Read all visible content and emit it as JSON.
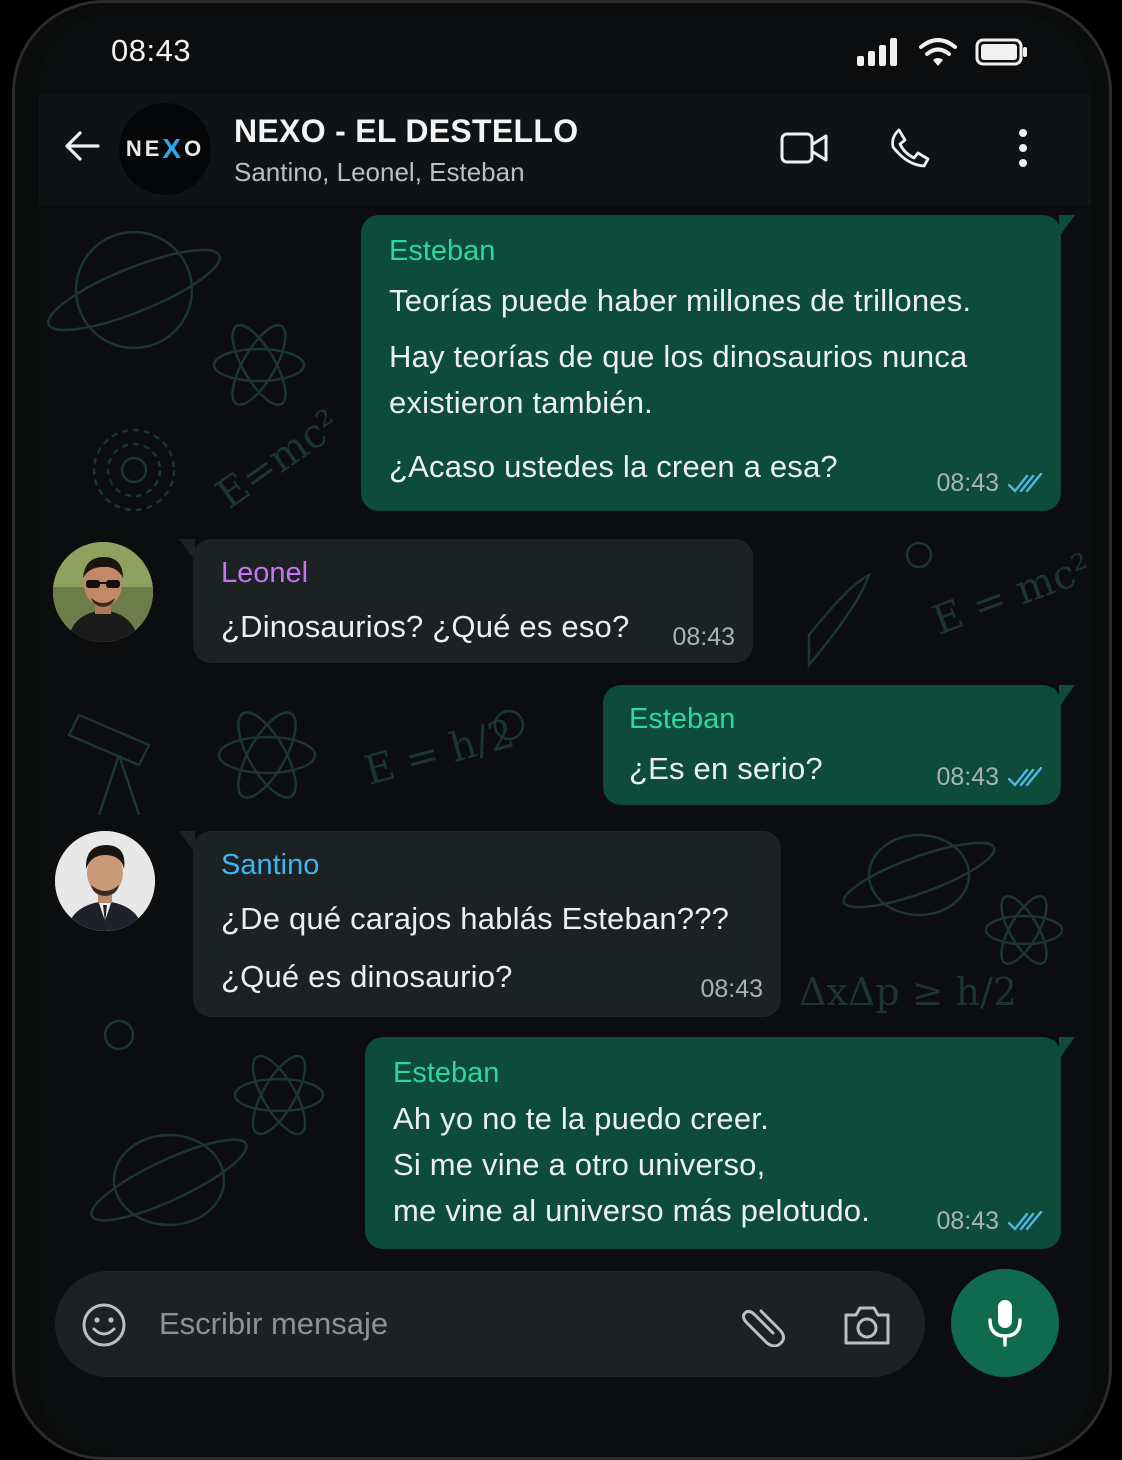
{
  "status_bar": {
    "time": "08:43"
  },
  "header": {
    "group_logo_left": "NE",
    "group_logo_mid": "X",
    "group_logo_right": "O",
    "title": "NEXO - EL DESTELLO",
    "members": "Santino, Leonel, Esteban"
  },
  "colors": {
    "outgoing_bubble": "#0d4c3a",
    "incoming_bubble": "#1c2124",
    "esteban": "#2fd6a0",
    "leonel": "#c774f2",
    "santino": "#3fb6f0",
    "read_ticks": "#4fb6e6",
    "mic_button": "#0f6a4e"
  },
  "messages": [
    {
      "sender": "Esteban",
      "direction": "out",
      "lines": [
        "Teorías puede haber millones de trillones.",
        "Hay teorías de que los dinosaurios nunca",
        "existieron también.",
        "¿Acaso ustedes la creen a esa?"
      ],
      "time": "08:43",
      "status": "read"
    },
    {
      "sender": "Leonel",
      "direction": "in",
      "lines": [
        "¿Dinosaurios? ¿Qué es eso?"
      ],
      "time": "08:43"
    },
    {
      "sender": "Esteban",
      "direction": "out",
      "lines": [
        "¿Es en serio?"
      ],
      "time": "08:43",
      "status": "read"
    },
    {
      "sender": "Santino",
      "direction": "in",
      "lines": [
        "¿De qué carajos hablás Esteban???",
        "¿Qué es dinosaurio?"
      ],
      "time": "08:43"
    },
    {
      "sender": "Esteban",
      "direction": "out",
      "lines": [
        "Ah yo no te la puedo creer.",
        "Si me vine a otro universo,",
        "me vine al universo más pelotudo."
      ],
      "time": "08:43",
      "status": "read"
    }
  ],
  "wallpaper_doodles": [
    "E = mc²",
    "E = mc²",
    "E = h/2",
    "ΔxΔp ≥ h/2"
  ],
  "composer": {
    "placeholder": "Escribir mensaje"
  },
  "icons": {
    "back": "arrow-left-icon",
    "video": "video-camera-icon",
    "call": "phone-icon",
    "menu": "more-vertical-icon",
    "emoji": "emoji-icon",
    "attach": "paperclip-icon",
    "camera": "camera-icon",
    "mic": "microphone-icon",
    "read": "double-check-icon"
  }
}
